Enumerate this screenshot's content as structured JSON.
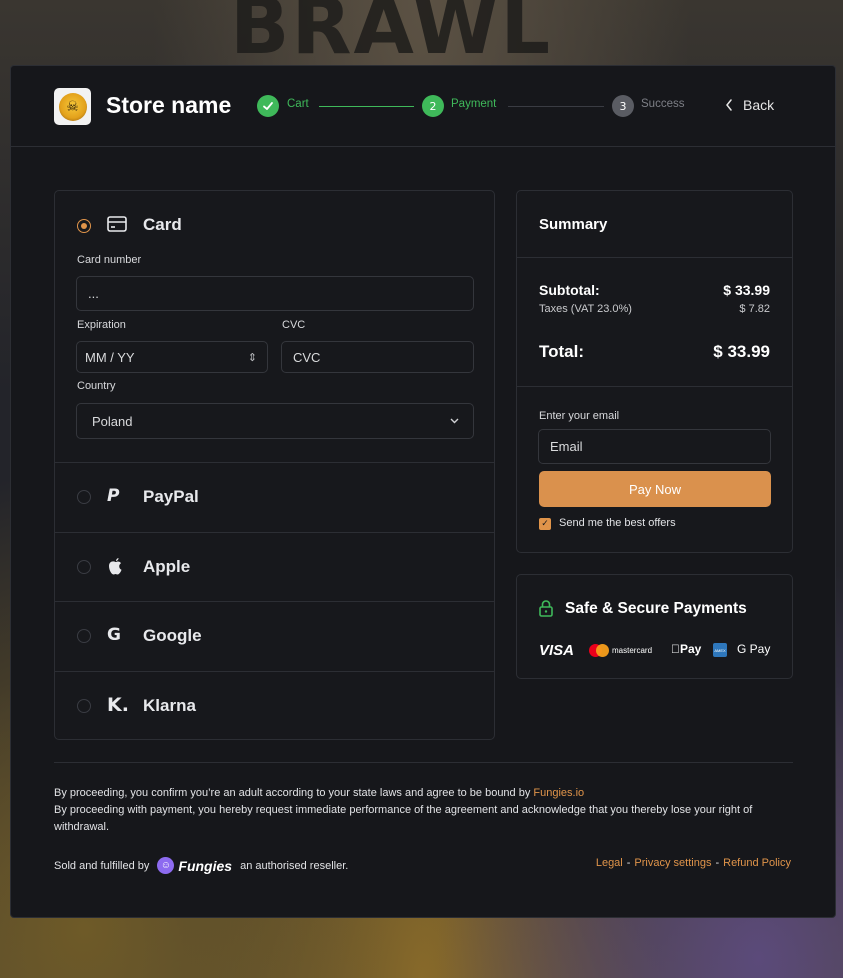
{
  "background": {
    "title": "BRAWL"
  },
  "header": {
    "store_name": "Store name",
    "steps": [
      {
        "number": "1",
        "label": "Cart",
        "state": "done"
      },
      {
        "number": "2",
        "label": "Payment",
        "state": "active"
      },
      {
        "number": "3",
        "label": "Success",
        "state": "pending"
      }
    ],
    "back_label": "Back"
  },
  "payment": {
    "selected": "Card",
    "card": {
      "label": "Card",
      "card_number_label": "Card number",
      "card_number_value": "...",
      "expiration_label": "Expiration",
      "expiration_placeholder": "MM / YY",
      "cvc_label": "CVC",
      "cvc_placeholder": "CVC",
      "country_label": "Country",
      "country_value": "Poland"
    },
    "methods": [
      {
        "label": "PayPal",
        "icon": "paypal-icon"
      },
      {
        "label": "Apple",
        "icon": "apple-icon"
      },
      {
        "label": "Google",
        "icon": "google-icon"
      },
      {
        "label": "Klarna",
        "icon": "klarna-icon"
      }
    ]
  },
  "summary": {
    "title": "Summary",
    "subtotal_label": "Subtotal:",
    "subtotal_value": "$ 33.99",
    "taxes_label": "Taxes (VAT 23.0%)",
    "taxes_value": "$ 7.82",
    "total_label": "Total:",
    "total_value": "$ 33.99",
    "email_label": "Enter your email",
    "email_placeholder": "Email",
    "pay_label": "Pay Now",
    "offers_label": "Send me the best offers",
    "offers_checked": true
  },
  "secure": {
    "title": "Safe & Secure Payments",
    "brands": [
      "VISA",
      "mastercard",
      "Pay",
      "AMEX",
      "G Pay"
    ]
  },
  "footer": {
    "legal_1_text": "By proceeding, you confirm you’re an adult according to your state laws and agree to be bound by ",
    "legal_1_link": "Fungies.io",
    "legal_2_text": "By proceeding with payment, you hereby request immediate performance of the agreement and acknowledge that you thereby lose your right of withdrawal.",
    "sold_prefix": "Sold and fulfilled by",
    "brand": "Fungies",
    "sold_suffix": "an authorised reseller.",
    "links": [
      "Legal",
      "Privacy settings",
      "Refund Policy"
    ],
    "separator": "-"
  },
  "colors": {
    "accent": "#e0944a",
    "success": "#3fb95a",
    "panel": "#16171b"
  }
}
